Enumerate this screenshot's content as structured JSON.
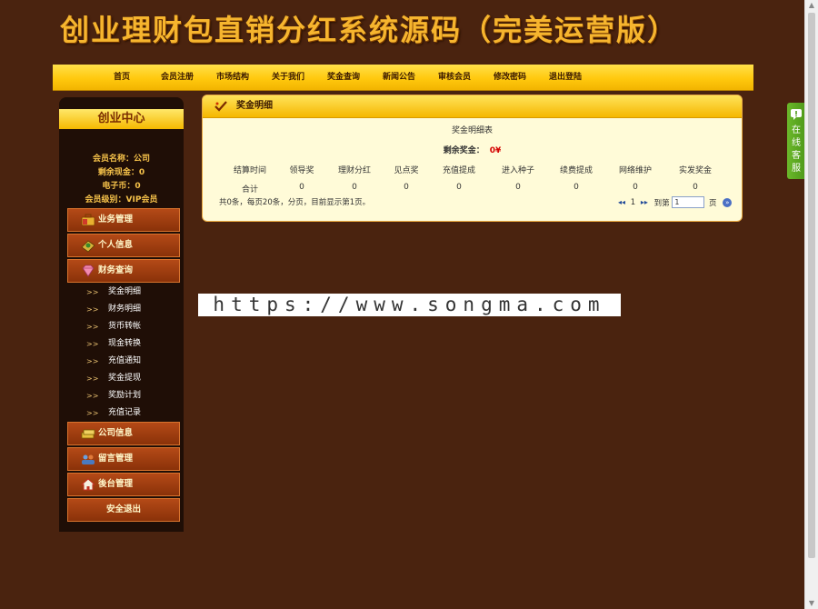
{
  "site": {
    "title": "创业理财包直销分红系统源码（完美运营版）"
  },
  "nav": {
    "items": [
      "首页",
      "会员注册",
      "市场结构",
      "关于我们",
      "奖金查询",
      "新闻公告",
      "审核会员",
      "修改密码",
      "退出登陆"
    ]
  },
  "sidebar": {
    "header": "创业中心",
    "member": {
      "name_line": "会员名称：公司",
      "cash_line": "剩余现金：0",
      "ecoin_line": "电子币：0",
      "level_line": "会员级别：VIP会员"
    },
    "menu": {
      "business": "业务管理",
      "personal": "个人信息",
      "finance": "财务查询",
      "company": "公司信息",
      "messages": "留言管理",
      "backend": "後台管理",
      "logout": "安全退出"
    },
    "sub_arrow": ">>",
    "finance_sub": [
      "奖金明细",
      "财务明细",
      "货币转帐",
      "现金转换",
      "充值通知",
      "奖金提现",
      "奖励计划",
      "充值记录"
    ]
  },
  "panel": {
    "title": "奖金明细",
    "caption": "奖金明细表",
    "balance_label": "剩余奖金：",
    "balance_value": "0¥",
    "columns": [
      "结算时间",
      "领导奖",
      "理财分红",
      "见点奖",
      "充值提成",
      "进入种子",
      "续费提成",
      "网络维护",
      "实发奖金"
    ],
    "row": [
      "合计",
      "0",
      "0",
      "0",
      "0",
      "0",
      "0",
      "0",
      "0"
    ],
    "summary": "共0条，每页20条，分页，目前显示第1页。",
    "pager": {
      "first": "◂◂",
      "current": "1",
      "next": "▸▸",
      "goto_label": "到第",
      "page_value": "1",
      "page_unit": "页",
      "go": "»"
    }
  },
  "watermark": "https://www.songma.com",
  "service_tab": {
    "label": "在线客服"
  },
  "colors": {
    "background": "#4a230f",
    "nav_yellow": "#ffc90e",
    "menu_brown": "#9a3a10",
    "panel_bg": "#fffbd8",
    "accent_red": "#d40000",
    "service_green": "#5aa820"
  }
}
